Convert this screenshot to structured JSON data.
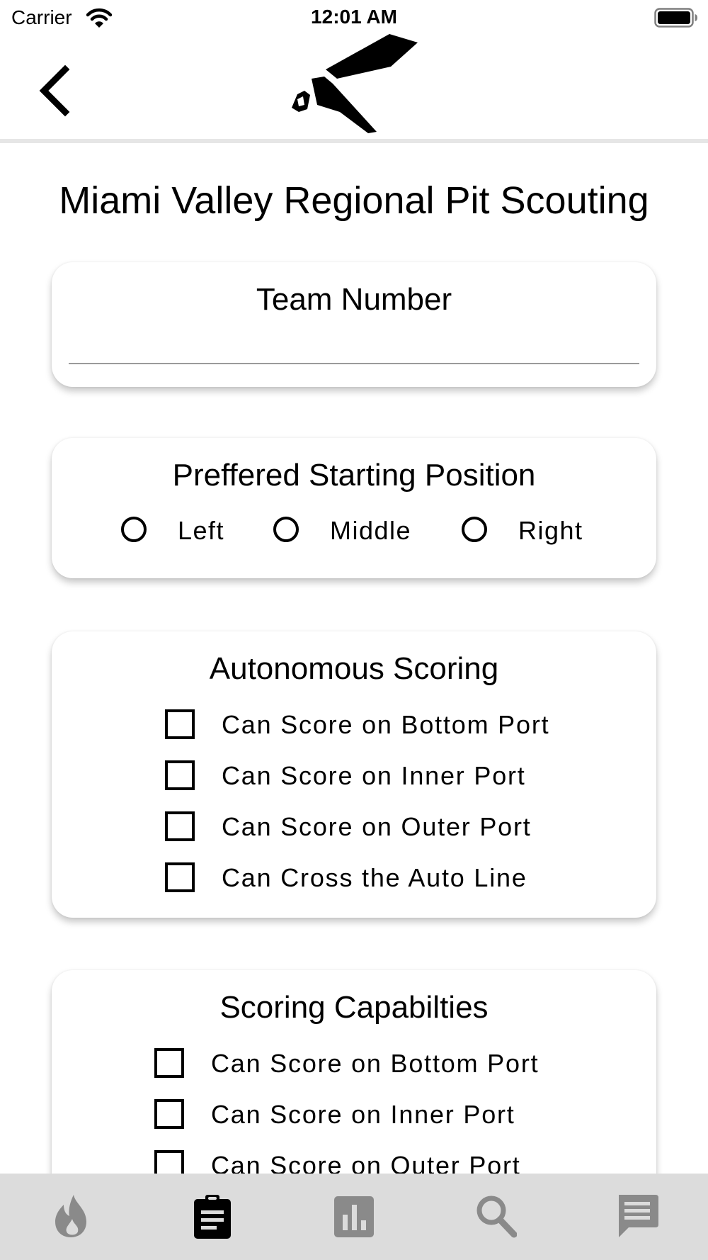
{
  "status_bar": {
    "carrier": "Carrier",
    "time": "12:01 AM"
  },
  "page": {
    "title": "Miami Valley Regional Pit Scouting"
  },
  "team_number": {
    "label": "Team Number",
    "value": ""
  },
  "starting_position": {
    "label": "Preffered Starting Position",
    "options": [
      "Left",
      "Middle",
      "Right"
    ],
    "selected": null
  },
  "autonomous_scoring": {
    "label": "Autonomous Scoring",
    "options": [
      "Can Score on Bottom Port",
      "Can Score on Inner Port",
      "Can Score on Outer Port",
      "Can Cross the Auto Line"
    ]
  },
  "scoring_capabilities": {
    "label": "Scoring Capabilties",
    "options": [
      "Can Score on Bottom Port",
      "Can Score on Inner Port",
      "Can Score on Outer Port"
    ]
  },
  "tab_bar": {
    "tabs": [
      {
        "icon": "flame-icon",
        "active": false
      },
      {
        "icon": "clipboard-icon",
        "active": true
      },
      {
        "icon": "bar-chart-icon",
        "active": false
      },
      {
        "icon": "search-icon",
        "active": false
      },
      {
        "icon": "chat-icon",
        "active": false
      }
    ],
    "active_color": "#000000",
    "inactive_color": "#8a8a8a"
  }
}
